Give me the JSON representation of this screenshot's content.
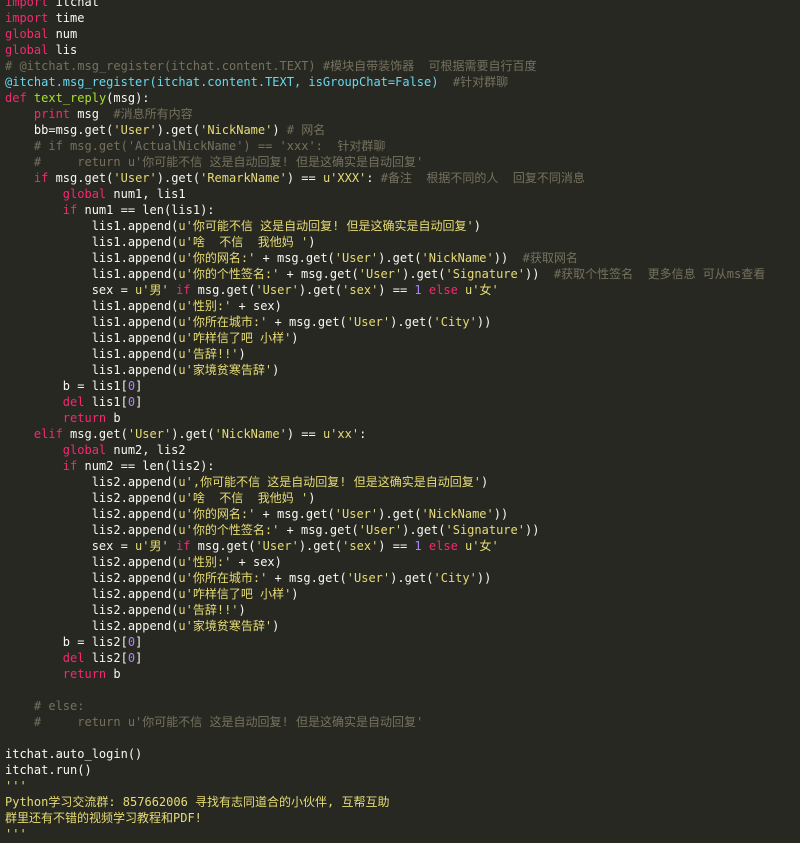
{
  "editor": {
    "language": "python",
    "lines": [
      [
        [
          "kw",
          "import"
        ],
        [
          "txt",
          " itchat"
        ]
      ],
      [
        [
          "kw",
          "import"
        ],
        [
          "txt",
          " time"
        ]
      ],
      [
        [
          "kw",
          "global"
        ],
        [
          "txt",
          " num"
        ]
      ],
      [
        [
          "kw",
          "global"
        ],
        [
          "txt",
          " lis"
        ]
      ],
      [
        [
          "cmt",
          "# @itchat.msg_register(itchat.content.TEXT) #模块自带装饰器  可根据需要自行百度"
        ]
      ],
      [
        [
          "dec",
          "@itchat.msg_register(itchat.content.TEXT, isGroupChat=False)"
        ],
        [
          "cmt",
          "  #针对群聊"
        ]
      ],
      [
        [
          "kw",
          "def"
        ],
        [
          "txt",
          " "
        ],
        [
          "fn",
          "text_reply"
        ],
        [
          "txt",
          "(msg):"
        ]
      ],
      [
        [
          "txt",
          "    "
        ],
        [
          "kw",
          "print"
        ],
        [
          "txt",
          " msg  "
        ],
        [
          "cmt",
          "#消息所有内容"
        ]
      ],
      [
        [
          "txt",
          "    bb=msg.get("
        ],
        [
          "str",
          "'User'"
        ],
        [
          "txt",
          ").get("
        ],
        [
          "str",
          "'NickName'"
        ],
        [
          "txt",
          ") "
        ],
        [
          "cmt",
          "# 网名"
        ]
      ],
      [
        [
          "txt",
          "    "
        ],
        [
          "cmt",
          "# if msg.get('ActualNickName') == 'xxx':  针对群聊"
        ]
      ],
      [
        [
          "txt",
          "    "
        ],
        [
          "cmt",
          "#     return u'你可能不信 这是自动回复! 但是这确实是自动回复'"
        ]
      ],
      [
        [
          "txt",
          "    "
        ],
        [
          "kw",
          "if"
        ],
        [
          "txt",
          " msg.get("
        ],
        [
          "str",
          "'User'"
        ],
        [
          "txt",
          ").get("
        ],
        [
          "str",
          "'RemarkName'"
        ],
        [
          "txt",
          ") == "
        ],
        [
          "str",
          "u'XXX'"
        ],
        [
          "txt",
          ": "
        ],
        [
          "cmt",
          "#备注  根据不同的人  回复不同消息"
        ]
      ],
      [
        [
          "txt",
          "        "
        ],
        [
          "kw",
          "global"
        ],
        [
          "txt",
          " num1, lis1"
        ]
      ],
      [
        [
          "txt",
          "        "
        ],
        [
          "kw",
          "if"
        ],
        [
          "txt",
          " num1 == len(lis1):"
        ]
      ],
      [
        [
          "txt",
          "            lis1.append("
        ],
        [
          "str",
          "u'你可能不信 这是自动回复! 但是这确实是自动回复'"
        ],
        [
          "txt",
          ")"
        ]
      ],
      [
        [
          "txt",
          "            lis1.append("
        ],
        [
          "str",
          "u'啥  不信  我他妈 '"
        ],
        [
          "txt",
          ")"
        ]
      ],
      [
        [
          "txt",
          "            lis1.append("
        ],
        [
          "str",
          "u'你的网名:'"
        ],
        [
          "txt",
          " + msg.get("
        ],
        [
          "str",
          "'User'"
        ],
        [
          "txt",
          ").get("
        ],
        [
          "str",
          "'NickName'"
        ],
        [
          "txt",
          "))  "
        ],
        [
          "cmt",
          "#获取网名"
        ]
      ],
      [
        [
          "txt",
          "            lis1.append("
        ],
        [
          "str",
          "u'你的个性签名:'"
        ],
        [
          "txt",
          " + msg.get("
        ],
        [
          "str",
          "'User'"
        ],
        [
          "txt",
          ").get("
        ],
        [
          "str",
          "'Signature'"
        ],
        [
          "txt",
          "))  "
        ],
        [
          "cmt",
          "#获取个性签名  更多信息 可从ms查看"
        ]
      ],
      [
        [
          "txt",
          "            sex = "
        ],
        [
          "str",
          "u'男'"
        ],
        [
          "txt",
          " "
        ],
        [
          "kw",
          "if"
        ],
        [
          "txt",
          " msg.get("
        ],
        [
          "str",
          "'User'"
        ],
        [
          "txt",
          ").get("
        ],
        [
          "str",
          "'sex'"
        ],
        [
          "txt",
          ") == "
        ],
        [
          "num",
          "1"
        ],
        [
          "txt",
          " "
        ],
        [
          "kw",
          "else"
        ],
        [
          "txt",
          " "
        ],
        [
          "str",
          "u'女'"
        ]
      ],
      [
        [
          "txt",
          "            lis1.append("
        ],
        [
          "str",
          "u'性别:'"
        ],
        [
          "txt",
          " + sex)"
        ]
      ],
      [
        [
          "txt",
          "            lis1.append("
        ],
        [
          "str",
          "u'你所在城市:'"
        ],
        [
          "txt",
          " + msg.get("
        ],
        [
          "str",
          "'User'"
        ],
        [
          "txt",
          ").get("
        ],
        [
          "str",
          "'City'"
        ],
        [
          "txt",
          "))"
        ]
      ],
      [
        [
          "txt",
          "            lis1.append("
        ],
        [
          "str",
          "u'咋样信了吧 小样'"
        ],
        [
          "txt",
          ")"
        ]
      ],
      [
        [
          "txt",
          "            lis1.append("
        ],
        [
          "str",
          "u'告辞!!'"
        ],
        [
          "txt",
          ")"
        ]
      ],
      [
        [
          "txt",
          "            lis1.append("
        ],
        [
          "str",
          "u'家境贫寒告辞'"
        ],
        [
          "txt",
          ")"
        ]
      ],
      [
        [
          "txt",
          "        b = lis1["
        ],
        [
          "num",
          "0"
        ],
        [
          "txt",
          "]"
        ]
      ],
      [
        [
          "txt",
          "        "
        ],
        [
          "kw",
          "del"
        ],
        [
          "txt",
          " lis1["
        ],
        [
          "num",
          "0"
        ],
        [
          "txt",
          "]"
        ]
      ],
      [
        [
          "txt",
          "        "
        ],
        [
          "kw",
          "return"
        ],
        [
          "txt",
          " b"
        ]
      ],
      [
        [
          "txt",
          "    "
        ],
        [
          "kw",
          "elif"
        ],
        [
          "txt",
          " msg.get("
        ],
        [
          "str",
          "'User'"
        ],
        [
          "txt",
          ").get("
        ],
        [
          "str",
          "'NickName'"
        ],
        [
          "txt",
          ") == "
        ],
        [
          "str",
          "u'xx'"
        ],
        [
          "txt",
          ":"
        ]
      ],
      [
        [
          "txt",
          "        "
        ],
        [
          "kw",
          "global"
        ],
        [
          "txt",
          " num2, lis2"
        ]
      ],
      [
        [
          "txt",
          "        "
        ],
        [
          "kw",
          "if"
        ],
        [
          "txt",
          " num2 == len(lis2):"
        ]
      ],
      [
        [
          "txt",
          "            lis2.append("
        ],
        [
          "str",
          "u',你可能不信 这是自动回复! 但是这确实是自动回复'"
        ],
        [
          "txt",
          ")"
        ]
      ],
      [
        [
          "txt",
          "            lis2.append("
        ],
        [
          "str",
          "u'啥  不信  我他妈 '"
        ],
        [
          "txt",
          ")"
        ]
      ],
      [
        [
          "txt",
          "            lis2.append("
        ],
        [
          "str",
          "u'你的网名:'"
        ],
        [
          "txt",
          " + msg.get("
        ],
        [
          "str",
          "'User'"
        ],
        [
          "txt",
          ").get("
        ],
        [
          "str",
          "'NickName'"
        ],
        [
          "txt",
          "))"
        ]
      ],
      [
        [
          "txt",
          "            lis2.append("
        ],
        [
          "str",
          "u'你的个性签名:'"
        ],
        [
          "txt",
          " + msg.get("
        ],
        [
          "str",
          "'User'"
        ],
        [
          "txt",
          ").get("
        ],
        [
          "str",
          "'Signature'"
        ],
        [
          "txt",
          "))"
        ]
      ],
      [
        [
          "txt",
          "            sex = "
        ],
        [
          "str",
          "u'男'"
        ],
        [
          "txt",
          " "
        ],
        [
          "kw",
          "if"
        ],
        [
          "txt",
          " msg.get("
        ],
        [
          "str",
          "'User'"
        ],
        [
          "txt",
          ").get("
        ],
        [
          "str",
          "'sex'"
        ],
        [
          "txt",
          ") == "
        ],
        [
          "num",
          "1"
        ],
        [
          "txt",
          " "
        ],
        [
          "kw",
          "else"
        ],
        [
          "txt",
          " "
        ],
        [
          "str",
          "u'女'"
        ]
      ],
      [
        [
          "txt",
          "            lis2.append("
        ],
        [
          "str",
          "u'性别:'"
        ],
        [
          "txt",
          " + sex)"
        ]
      ],
      [
        [
          "txt",
          "            lis2.append("
        ],
        [
          "str",
          "u'你所在城市:'"
        ],
        [
          "txt",
          " + msg.get("
        ],
        [
          "str",
          "'User'"
        ],
        [
          "txt",
          ").get("
        ],
        [
          "str",
          "'City'"
        ],
        [
          "txt",
          "))"
        ]
      ],
      [
        [
          "txt",
          "            lis2.append("
        ],
        [
          "str",
          "u'咋样信了吧 小样'"
        ],
        [
          "txt",
          ")"
        ]
      ],
      [
        [
          "txt",
          "            lis2.append("
        ],
        [
          "str",
          "u'告辞!!'"
        ],
        [
          "txt",
          ")"
        ]
      ],
      [
        [
          "txt",
          "            lis2.append("
        ],
        [
          "str",
          "u'家境贫寒告辞'"
        ],
        [
          "txt",
          ")"
        ]
      ],
      [
        [
          "txt",
          "        b = lis2["
        ],
        [
          "num",
          "0"
        ],
        [
          "txt",
          "]"
        ]
      ],
      [
        [
          "txt",
          "        "
        ],
        [
          "kw",
          "del"
        ],
        [
          "txt",
          " lis2["
        ],
        [
          "num",
          "0"
        ],
        [
          "txt",
          "]"
        ]
      ],
      [
        [
          "txt",
          "        "
        ],
        [
          "kw",
          "return"
        ],
        [
          "txt",
          " b"
        ]
      ],
      [
        [
          "txt",
          ""
        ]
      ],
      [
        [
          "txt",
          "    "
        ],
        [
          "cmt",
          "# else:"
        ]
      ],
      [
        [
          "txt",
          "    "
        ],
        [
          "cmt",
          "#     return u'你可能不信 这是自动回复! 但是这确实是自动回复'"
        ]
      ],
      [
        [
          "txt",
          ""
        ]
      ],
      [
        [
          "txt",
          "itchat.auto_login()"
        ]
      ],
      [
        [
          "txt",
          "itchat.run()"
        ]
      ],
      [
        [
          "str",
          "'''"
        ]
      ],
      [
        [
          "str",
          "Python学习交流群: 857662006 寻找有志同道合的小伙伴, 互帮互助"
        ]
      ],
      [
        [
          "str",
          "群里还有不错的视频学习教程和PDF!"
        ]
      ],
      [
        [
          "str",
          "'''"
        ]
      ]
    ]
  }
}
